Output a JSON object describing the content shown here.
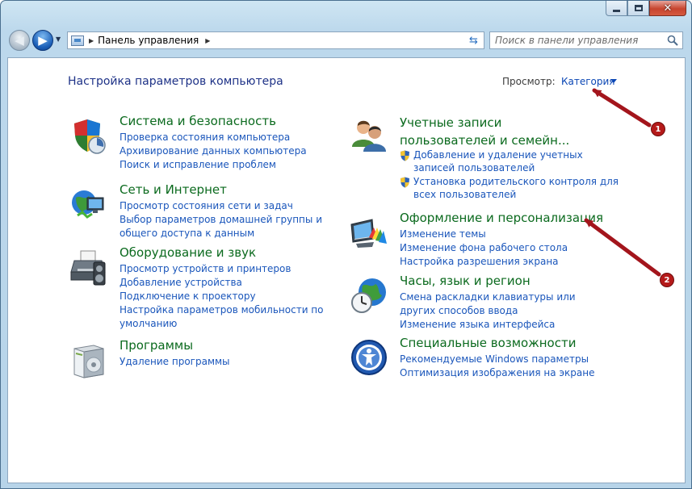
{
  "window": {
    "address": "Панель управления",
    "search_placeholder": "Поиск в панели управления"
  },
  "header": {
    "title": "Настройка параметров компьютера",
    "view_label": "Просмотр:",
    "view_value": "Категория"
  },
  "categories": {
    "system": {
      "title": "Система и безопасность",
      "links": [
        "Проверка состояния компьютера",
        "Архивирование данных компьютера",
        "Поиск и исправление проблем"
      ]
    },
    "network": {
      "title": "Сеть и Интернет",
      "links": [
        "Просмотр состояния сети и задач",
        "Выбор параметров домашней группы и общего доступа к данным"
      ]
    },
    "hardware": {
      "title": "Оборудование и звук",
      "links": [
        "Просмотр устройств и принтеров",
        "Добавление устройства",
        "Подключение к проектору",
        "Настройка параметров мобильности по умолчанию"
      ]
    },
    "programs": {
      "title": "Программы",
      "links": [
        "Удаление программы"
      ]
    },
    "users": {
      "title": "Учетные записи пользователей и семейн...",
      "links": [
        "Добавление и удаление учетных записей пользователей",
        "Установка родительского контроля для всех пользователей"
      ]
    },
    "appearance": {
      "title": "Оформление и персонализация",
      "links": [
        "Изменение темы",
        "Изменение фона рабочего стола",
        "Настройка разрешения экрана"
      ]
    },
    "clock": {
      "title": "Часы, язык и регион",
      "links": [
        "Смена раскладки клавиатуры или других способов ввода",
        "Изменение языка интерфейса"
      ]
    },
    "access": {
      "title": "Специальные возможности",
      "links": [
        "Рекомендуемые Windows параметры",
        "Оптимизация изображения на экране"
      ]
    }
  },
  "annotations": {
    "badge1": "1",
    "badge2": "2",
    "color": "#a3151c"
  }
}
